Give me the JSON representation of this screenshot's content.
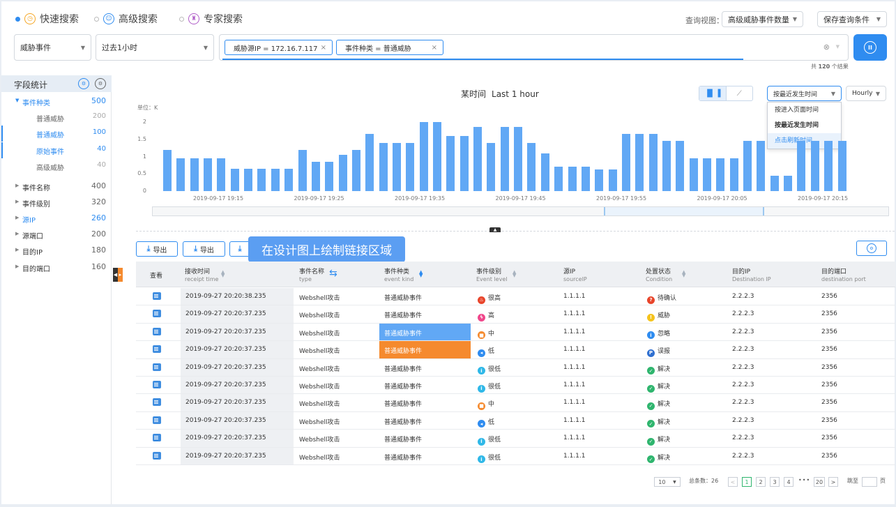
{
  "search_modes": [
    {
      "label": "快速搜索",
      "active": true
    },
    {
      "label": "高级搜索",
      "active": false
    },
    {
      "label": "专家搜索",
      "active": false
    }
  ],
  "query_view": {
    "label": "查询视图：",
    "value": "高级威胁事件数量"
  },
  "save_query": "保存查询条件",
  "filters": {
    "category": "威胁事件",
    "time_range": "过去1小时",
    "tags": [
      "威胁源IP = 172.16.7.117",
      "事件种类 = 普通威胁"
    ],
    "result_prefix": "共",
    "result_count": "120",
    "result_suffix": "个结果"
  },
  "sidebar": {
    "title": "字段统计",
    "items": [
      {
        "label": "事件种类",
        "count": "500",
        "expanded": true,
        "level": 0
      },
      {
        "label": "普通威胁",
        "count": "200",
        "level": 1
      },
      {
        "label": "普通威胁",
        "count": "100",
        "level": 1,
        "selected": true
      },
      {
        "label": "原始事件",
        "count": "40",
        "level": 1,
        "selected": true
      },
      {
        "label": "高级威胁",
        "count": "40",
        "level": 1
      },
      {
        "label": "事件名称",
        "count": "400",
        "level": 0
      },
      {
        "label": "事件级别",
        "count": "320",
        "level": 0
      },
      {
        "label": "源IP",
        "count": "260",
        "level": 0,
        "highlight": true
      },
      {
        "label": "源端口",
        "count": "200",
        "level": 0
      },
      {
        "label": "目的IP",
        "count": "180",
        "level": 0
      },
      {
        "label": "目的端口",
        "count": "160",
        "level": 0
      }
    ]
  },
  "chart_header": {
    "title": "某时间",
    "range": "Last 1 hour",
    "sort_value": "按最近发生时间",
    "interval": "Hourly",
    "sort_options": [
      "按进入页面时间",
      "按最近发生时间",
      "点击刷新时间"
    ]
  },
  "chart_data": {
    "type": "bar",
    "unit_label": "单位：K",
    "ylim": [
      0,
      2
    ],
    "yticks": [
      "0",
      "0.5",
      "1",
      "1.5",
      "2"
    ],
    "xtick_labels": [
      "2019-09-17 19:15",
      "2019-09-17 19:25",
      "2019-09-17 19:35",
      "2019-09-17 19:45",
      "2019-09-17 19:55",
      "2019-09-17 20:05",
      "2019-09-17 20:15"
    ],
    "values": [
      1.2,
      0.95,
      0.95,
      0.95,
      0.95,
      0.65,
      0.65,
      0.65,
      0.65,
      0.65,
      1.2,
      0.85,
      0.85,
      1.05,
      1.2,
      1.65,
      1.4,
      1.4,
      1.4,
      2.0,
      2.0,
      1.6,
      1.6,
      1.85,
      1.4,
      1.85,
      1.85,
      1.4,
      1.1,
      0.7,
      0.7,
      0.7,
      0.62,
      0.62,
      1.65,
      1.65,
      1.65,
      1.45,
      1.45,
      0.95,
      0.95,
      0.95,
      0.95,
      1.45,
      1.45,
      0.45,
      0.45,
      1.45,
      1.45,
      1.45,
      1.45
    ],
    "grid": false,
    "legend": "none"
  },
  "toolbar": {
    "export1": "导出",
    "export2": "导出",
    "tooltip": "在设计图上绘制链接区域"
  },
  "table": {
    "columns": [
      {
        "cn": "查看",
        "en": ""
      },
      {
        "cn": "接收时间",
        "en": "receipt time"
      },
      {
        "cn": "事件名称",
        "en": "type"
      },
      {
        "cn": "事件种类",
        "en": "event kind"
      },
      {
        "cn": "事件级别",
        "en": "Event level"
      },
      {
        "cn": "源IP",
        "en": "sourceIP"
      },
      {
        "cn": "处置状态",
        "en": "Condition"
      },
      {
        "cn": "目的IP",
        "en": "Destination IP"
      },
      {
        "cn": "目的端口",
        "en": "destination port"
      }
    ],
    "rows": [
      {
        "time": "2019-09-27  20:20:38.235",
        "type": "Webshell攻击",
        "kind": "普通威胁事件",
        "level": "很高",
        "level_color": "#e8452b",
        "level_icon": "fire-icon",
        "src": "1.1.1.1",
        "cond": "待确认",
        "cond_color": "#e8452b",
        "cond_icon": "question-icon",
        "dst": "2.2.2.3",
        "port": "2356",
        "hl": ""
      },
      {
        "time": "2019-09-27  20:20:37.235",
        "type": "Webshell攻击",
        "kind": "普通威胁事件",
        "level": "高",
        "level_color": "#f0478b",
        "level_icon": "bolt-icon",
        "src": "1.1.1.1",
        "cond": "威胁",
        "cond_color": "#f5c31d",
        "cond_icon": "exclaim-icon",
        "dst": "2.2.2.3",
        "port": "2356",
        "hl": ""
      },
      {
        "time": "2019-09-27  20:20:37.235",
        "type": "Webshell攻击",
        "kind": "普通威胁事件",
        "level": "中",
        "level_color": "#f58a2e",
        "level_icon": "lock-icon",
        "src": "1.1.1.1",
        "cond": "忽略",
        "cond_color": "#2f8cf0",
        "cond_icon": "info-icon",
        "dst": "2.2.2.3",
        "port": "2356",
        "hl": "blue"
      },
      {
        "time": "2019-09-27  20:20:37.235",
        "type": "Webshell攻击",
        "kind": "普通威胁事件",
        "level": "低",
        "level_color": "#2f8cf0",
        "level_icon": "speaker-icon",
        "src": "1.1.1.1",
        "cond": "误报",
        "cond_color": "#2f6fd0",
        "cond_icon": "p-icon",
        "dst": "2.2.2.3",
        "port": "2356",
        "hl": "orange"
      },
      {
        "time": "2019-09-27  20:20:37.235",
        "type": "Webshell攻击",
        "kind": "普通威胁事件",
        "level": "很低",
        "level_color": "#2fb8e8",
        "level_icon": "info-icon",
        "src": "1.1.1.1",
        "cond": "解决",
        "cond_color": "#2fb56e",
        "cond_icon": "check-icon",
        "dst": "2.2.2.3",
        "port": "2356",
        "hl": ""
      },
      {
        "time": "2019-09-27  20:20:37.235",
        "type": "Webshell攻击",
        "kind": "普通威胁事件",
        "level": "很低",
        "level_color": "#2fb8e8",
        "level_icon": "info-icon",
        "src": "1.1.1.1",
        "cond": "解决",
        "cond_color": "#2fb56e",
        "cond_icon": "check-icon",
        "dst": "2.2.2.3",
        "port": "2356",
        "hl": ""
      },
      {
        "time": "2019-09-27  20:20:37.235",
        "type": "Webshell攻击",
        "kind": "普通威胁事件",
        "level": "中",
        "level_color": "#f58a2e",
        "level_icon": "lock-icon",
        "src": "1.1.1.1",
        "cond": "解决",
        "cond_color": "#2fb56e",
        "cond_icon": "check-icon",
        "dst": "2.2.2.3",
        "port": "2356",
        "hl": ""
      },
      {
        "time": "2019-09-27  20:20:37.235",
        "type": "Webshell攻击",
        "kind": "普通威胁事件",
        "level": "低",
        "level_color": "#2f8cf0",
        "level_icon": "speaker-icon",
        "src": "1.1.1.1",
        "cond": "解决",
        "cond_color": "#2fb56e",
        "cond_icon": "check-icon",
        "dst": "2.2.2.3",
        "port": "2356",
        "hl": ""
      },
      {
        "time": "2019-09-27  20:20:37.235",
        "type": "Webshell攻击",
        "kind": "普通威胁事件",
        "level": "很低",
        "level_color": "#2fb8e8",
        "level_icon": "info-icon",
        "src": "1.1.1.1",
        "cond": "解决",
        "cond_color": "#2fb56e",
        "cond_icon": "check-icon",
        "dst": "2.2.2.3",
        "port": "2356",
        "hl": ""
      },
      {
        "time": "2019-09-27  20:20:37.235",
        "type": "Webshell攻击",
        "kind": "普通威胁事件",
        "level": "很低",
        "level_color": "#2fb8e8",
        "level_icon": "info-icon",
        "src": "1.1.1.1",
        "cond": "解决",
        "cond_color": "#2fb56e",
        "cond_icon": "check-icon",
        "dst": "2.2.2.3",
        "port": "2356",
        "hl": ""
      }
    ]
  },
  "pagination": {
    "page_size": "10",
    "total": "总条数：26",
    "pages": [
      "1",
      "2",
      "3",
      "4"
    ],
    "ellipsis": "•••",
    "last_page": "20",
    "goto_label": "跳至",
    "goto_suffix": "页",
    "current": "1"
  },
  "colors": {
    "accent": "#2f8cf0",
    "bar": "#61a8f5",
    "orange": "#f58a2e"
  }
}
